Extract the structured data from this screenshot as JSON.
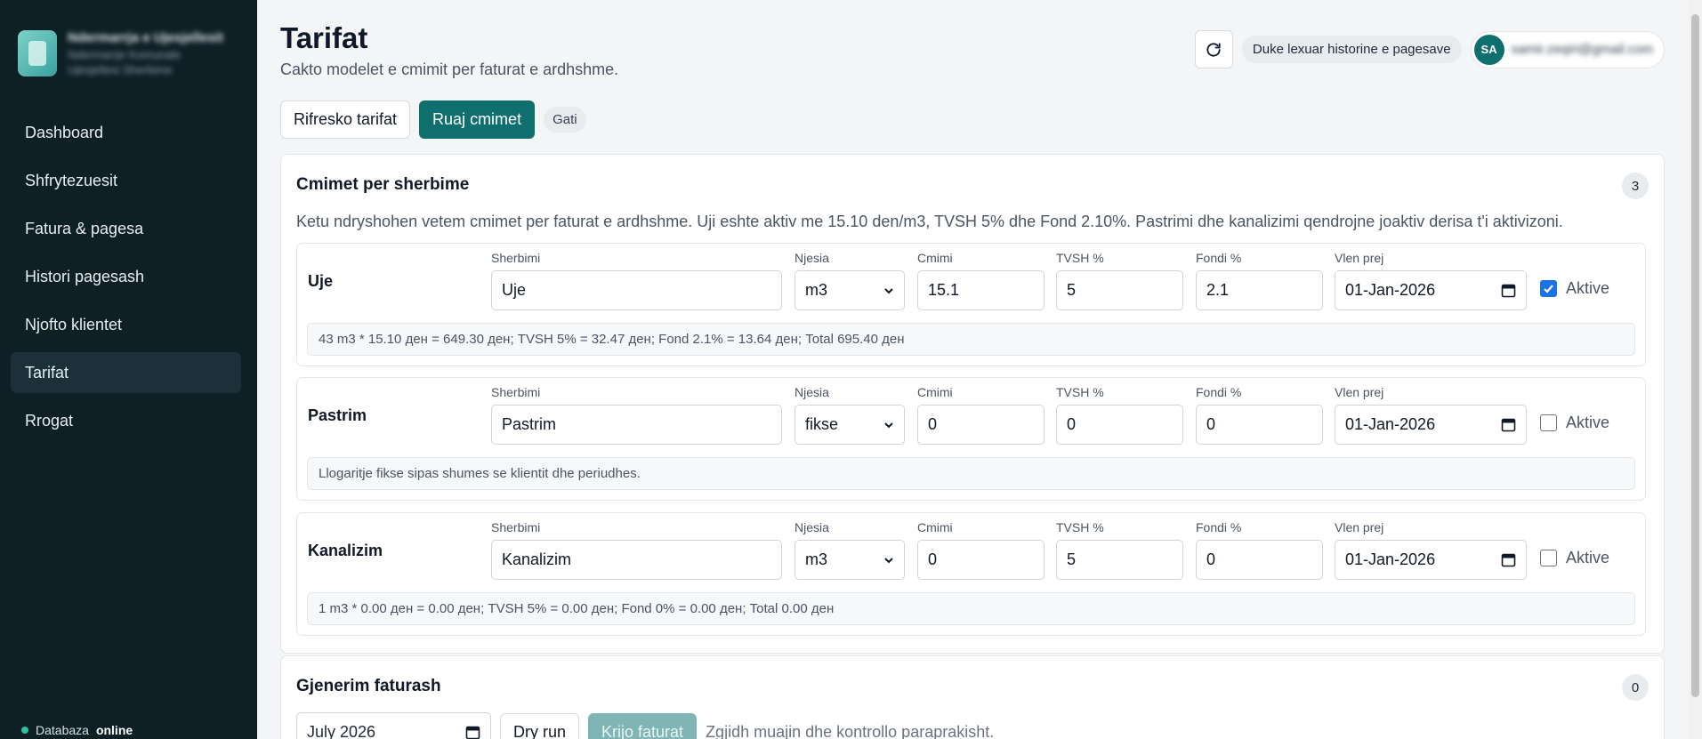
{
  "sidebar": {
    "brand_name": "Ndermarrja e Ujesjellesit",
    "brand_sub1": "Ndermarrje Komunale",
    "brand_sub2": "Ujesjellesi Sherbime",
    "items": [
      {
        "label": "Dashboard"
      },
      {
        "label": "Shfrytezuesit"
      },
      {
        "label": "Fatura & pagesa"
      },
      {
        "label": "Histori pagesash"
      },
      {
        "label": "Njofto klientet"
      },
      {
        "label": "Tarifat"
      },
      {
        "label": "Rrogat"
      }
    ],
    "active_index": 5,
    "db_label": "Databaza",
    "db_status": "online"
  },
  "header": {
    "title": "Tarifat",
    "subtitle": "Cakto modelet e cmimit per faturat e ardhshme.",
    "history_status": "Duke lexuar historine e pagesave",
    "avatar_initials": "SA",
    "user_email": "samir.zeqiri@gmail.com"
  },
  "toolbar": {
    "refresh_label": "Rifresko tarifat",
    "save_label": "Ruaj cmimet",
    "status": "Gati"
  },
  "prices_card": {
    "title": "Cmimet per sherbime",
    "count": "3",
    "description": "Ketu ndryshohen vetem cmimet per faturat e ardhshme. Uji eshte aktiv me 15.10 den/m3, TVSH 5% dhe Fond 2.10%. Pastrimi dhe kanalizimi qendrojne joaktiv derisa t'i aktivizoni.",
    "labels": {
      "service": "Sherbimi",
      "unit": "Njesia",
      "price": "Cmimi",
      "vat": "TVSH %",
      "fund": "Fondi %",
      "valid_from": "Vlen prej",
      "active": "Aktive"
    },
    "services": [
      {
        "name": "Uje",
        "service": "Uje",
        "unit": "m3",
        "price": "15.1",
        "vat": "5",
        "fund": "2.1",
        "valid_from": "01-Jan-2026",
        "active": true,
        "note": "43 m3 * 15.10 ден = 649.30 ден; TVSH 5% = 32.47 ден; Fond 2.1% = 13.64 ден; Total 695.40 ден"
      },
      {
        "name": "Pastrim",
        "service": "Pastrim",
        "unit": "fikse",
        "price": "0",
        "vat": "0",
        "fund": "0",
        "valid_from": "01-Jan-2026",
        "active": false,
        "note": "Llogaritje fikse sipas shumes se klientit dhe periudhes."
      },
      {
        "name": "Kanalizim",
        "service": "Kanalizim",
        "unit": "m3",
        "price": "0",
        "vat": "5",
        "fund": "0",
        "valid_from": "01-Jan-2026",
        "active": false,
        "note": "1 m3 * 0.00 ден = 0.00 ден; TVSH 5% = 0.00 ден; Fond 0% = 0.00 ден; Total 0.00 ден"
      }
    ]
  },
  "generation_card": {
    "title": "Gjenerim faturash",
    "count": "0",
    "month": "July 2026",
    "dry_run_label": "Dry run",
    "create_label": "Krijo faturat",
    "hint": "Zgjidh muajin dhe kontrollo paraprakisht."
  },
  "colors": {
    "accent": "#0f6f6f",
    "sidebar_bg": "#0f1f26",
    "checkbox": "#1a73e8",
    "online_dot": "#2fbf9c"
  }
}
